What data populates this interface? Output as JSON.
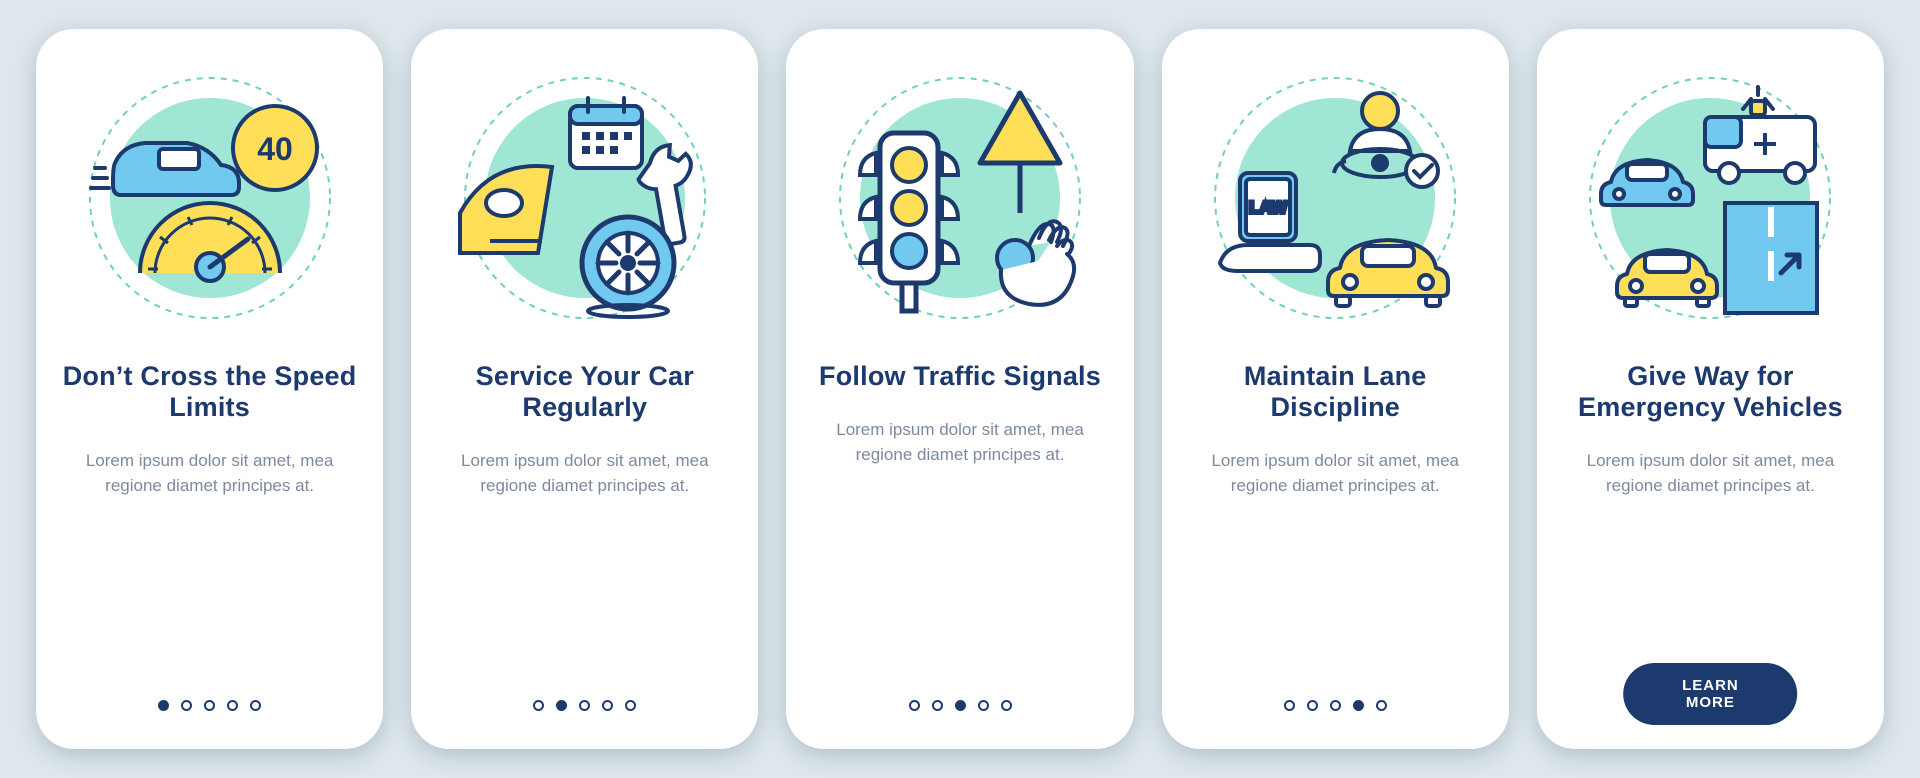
{
  "colors": {
    "navy": "#1d3a6e",
    "mint": "#9fe6d4",
    "yellow": "#ffde58",
    "sky": "#72c9f0"
  },
  "cta_label": "LEARN MORE",
  "cards": [
    {
      "id": "speed-limits",
      "icon": "speed-limit-icon",
      "title": "Don’t Cross the Speed Limits",
      "body": "Lorem ipsum dolor sit amet, mea regione diamet principes at.",
      "active_dot": 0,
      "speed_sign": "40"
    },
    {
      "id": "service-car",
      "icon": "car-service-icon",
      "title": "Service Your Car Regularly",
      "body": "Lorem ipsum dolor sit amet, mea regione diamet principes at.",
      "active_dot": 1
    },
    {
      "id": "traffic-signals",
      "icon": "traffic-signal-icon",
      "title": "Follow Traffic Signals",
      "body": "Lorem ipsum dolor sit amet, mea regione diamet principes at.",
      "active_dot": 2
    },
    {
      "id": "lane-discipline",
      "icon": "lane-discipline-icon",
      "title": "Maintain Lane Discipline",
      "body": "Lorem ipsum dolor sit amet, mea regione diamet principes at.",
      "active_dot": 3,
      "law_label": "LAW"
    },
    {
      "id": "emergency-vehicles",
      "icon": "emergency-vehicle-icon",
      "title": "Give Way for Emergency Vehicles",
      "body": "Lorem ipsum dolor sit amet, mea regione diamet principes at.",
      "active_dot": 4,
      "shows_cta": true
    }
  ]
}
